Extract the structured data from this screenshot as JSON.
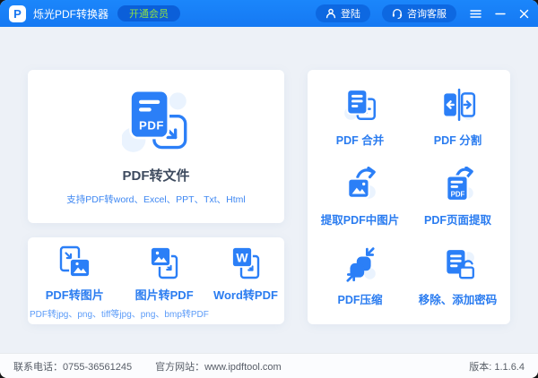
{
  "titlebar": {
    "app_title": "烁光PDF转换器",
    "logo_letter": "P",
    "vip_badge_label": "开通会员",
    "login_label": "登陆",
    "service_label": "咨询客服"
  },
  "main_card": {
    "title": "PDF转文件",
    "subtitle": "支持PDF转word、Excel、PPT、Txt、Html"
  },
  "left_tools": [
    {
      "label": "PDF转图片",
      "sub": "PDF转jpg、png、tiff等",
      "icon": "pdf-to-image-icon"
    },
    {
      "label": "图片转PDF",
      "sub": "jpg、png、bmp转PDF",
      "icon": "image-to-pdf-icon"
    },
    {
      "label": "Word转PDF",
      "sub": "",
      "icon": "word-to-pdf-icon"
    }
  ],
  "right_tools": [
    {
      "label": "PDF 合并",
      "icon": "pdf-merge-icon"
    },
    {
      "label": "PDF 分割",
      "icon": "pdf-split-icon"
    },
    {
      "label": "提取PDF中图片",
      "icon": "extract-pdf-images-icon"
    },
    {
      "label": "PDF页面提取",
      "icon": "pdf-page-extract-icon"
    },
    {
      "label": "PDF压缩",
      "icon": "pdf-compress-icon"
    },
    {
      "label": "移除、添加密码",
      "icon": "password-icon"
    }
  ],
  "footer": {
    "phone": "联系电话：0755-36561245",
    "website": "官方网站：www.ipdftool.com",
    "version": "版本: 1.1.6.4"
  },
  "colors": {
    "titlebar_blue": "#1781fa",
    "accent_blue": "#2b7ff7",
    "badge_bg": "#0b5fd9",
    "badge_text_green": "#8ce045",
    "page_background": "#edf1f7",
    "label_blue": "#2a7cf0",
    "sublabel_blue": "#5b9bf8",
    "main_title_dark": "#3d4a5e"
  }
}
